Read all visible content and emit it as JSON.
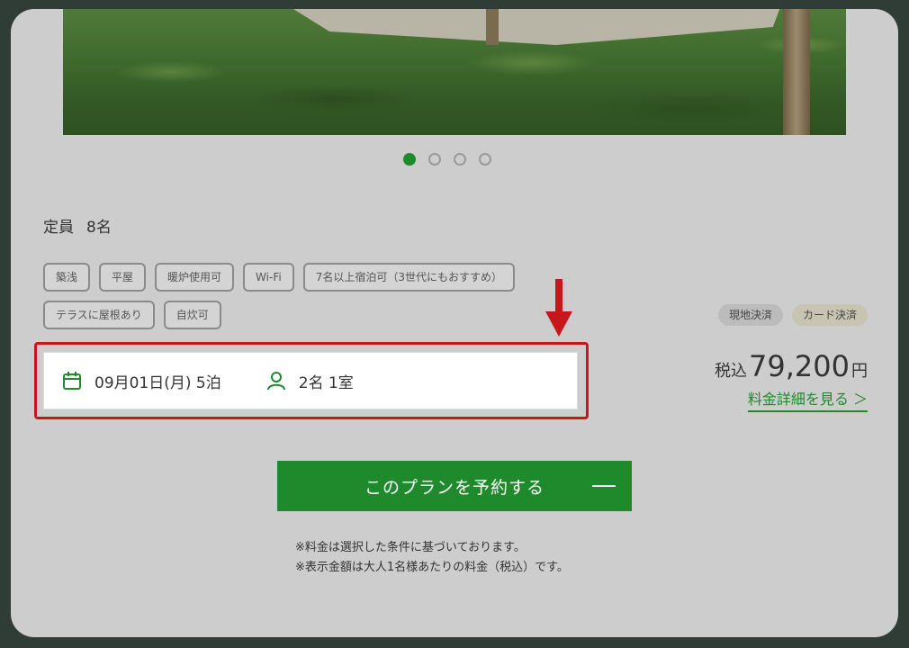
{
  "gallery": {
    "slide_count": 4,
    "active_index": 0
  },
  "capacity": {
    "label": "定員",
    "value": "8名"
  },
  "tags": [
    "築浅",
    "平屋",
    "暖炉使用可",
    "Wi-Fi",
    "7名以上宿泊可（3世代にもおすすめ）",
    "テラスに屋根あり",
    "自炊可"
  ],
  "search": {
    "date": "09月01日(月) 5泊",
    "guests": "2名 1室"
  },
  "payment": {
    "local": "現地決済",
    "card": "カード決済"
  },
  "price": {
    "prefix": "税込",
    "amount": "79,200",
    "unit": "円",
    "detail_link": "料金詳細を見る ＞"
  },
  "cta": {
    "label": "このプランを予約する"
  },
  "notes": [
    "※料金は選択した条件に基づいております。",
    "※表示金額は大人1名様あたりの料金（税込）です。"
  ],
  "colors": {
    "accent": "#1f8a2b",
    "highlight": "#c8161d",
    "frame": "#2f3d36",
    "background": "#cdcdcd"
  },
  "icons": {
    "date": "calendar-icon",
    "guests": "person-icon",
    "pointer": "arrow-down-icon"
  }
}
